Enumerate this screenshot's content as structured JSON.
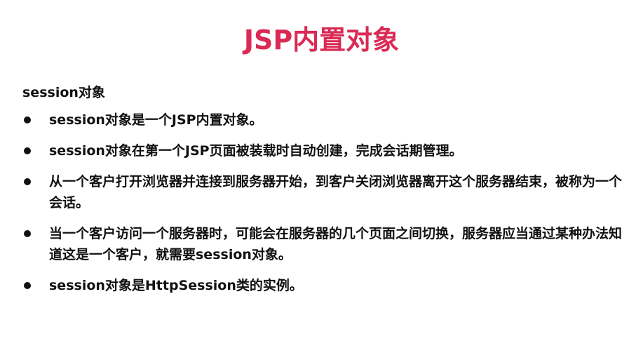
{
  "slide": {
    "title": "JSP内置对象",
    "section_heading": "session对象",
    "bullets": [
      "session对象是一个JSP内置对象。",
      "session对象在第一个JSP页面被装载时自动创建，完成会话期管理。",
      "从一个客户打开浏览器并连接到服务器开始，到客户关闭浏览器离开这个服务器结束，被称为一个会话。",
      "当一个客户访问一个服务器时，可能会在服务器的几个页面之间切换，服务器应当通过某种办法知道这是一个客户，就需要session对象。",
      "session对象是HttpSession类的实例。"
    ]
  },
  "colors": {
    "title": "#d92b55",
    "text": "#111111",
    "background": "#ffffff"
  }
}
